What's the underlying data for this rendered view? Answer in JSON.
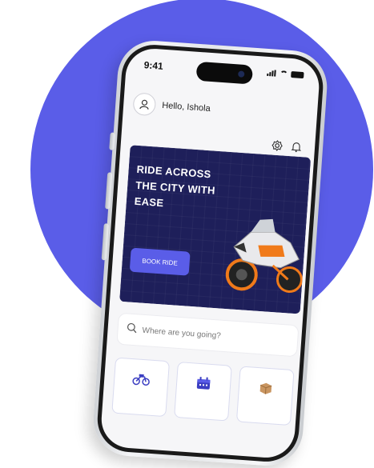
{
  "status_bar": {
    "time": "9:41"
  },
  "header": {
    "greeting": "Hello, Ishola"
  },
  "banner": {
    "title": "RIDE ACROSS THE CITY WITH EASE",
    "button_label": "BOOK RIDE"
  },
  "search": {
    "placeholder": "Where are you going?"
  },
  "icons": [
    "user-icon",
    "gear-icon",
    "bell-icon",
    "search-icon",
    "motorbike-icon",
    "calendar-icon",
    "package-icon"
  ],
  "colors": {
    "accent": "#5a5de8",
    "banner_bg": "#1e1f5a",
    "bike_orange": "#f07a1a"
  }
}
